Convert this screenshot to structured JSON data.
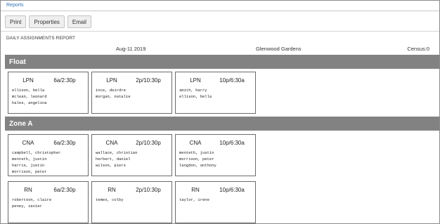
{
  "breadcrumb": "Reports",
  "toolbar": {
    "print": "Print",
    "properties": "Properties",
    "email": "Email"
  },
  "report": {
    "title": "DAILY ASSIGNMENTS REPORT",
    "date": "Aug-11 2019",
    "facility": "Glenwood Gardens",
    "census": "Census:0"
  },
  "zones": [
    {
      "name": "Float",
      "rows": [
        [
          {
            "role": "LPN",
            "shift": "6a/2:30p",
            "staff": [
              "ellison, bella",
              "mclean, leonard",
              "hales, angelina"
            ]
          },
          {
            "role": "LPN",
            "shift": "2p/10:30p",
            "staff": [
              "ince, deirdre",
              "morgan, natalie"
            ]
          },
          {
            "role": "LPN",
            "shift": "10p/6:30a",
            "staff": [
              "smith, harry",
              "ellison, bella"
            ]
          }
        ]
      ]
    },
    {
      "name": "Zone A",
      "rows": [
        [
          {
            "role": "CNA",
            "shift": "6a/2:30p",
            "staff": [
              "campbell, christopher",
              "menteth, justin",
              "harris, justin",
              "morrison, peter"
            ]
          },
          {
            "role": "CNA",
            "shift": "2p/10:30p",
            "staff": [
              "wallace, christian",
              "herbert, daniel",
              "wilson, piers"
            ]
          },
          {
            "role": "CNA",
            "shift": "10p/6:30a",
            "staff": [
              "menteth, justin",
              "morrison, peter",
              "langdon, anthony"
            ]
          }
        ],
        [
          {
            "role": "RN",
            "shift": "6a/2:30p",
            "staff": [
              "robertson, claire",
              "peney, xavier"
            ]
          },
          {
            "role": "RN",
            "shift": "2p/10:30p",
            "staff": [
              "temes, colby"
            ]
          },
          {
            "role": "RN",
            "shift": "10p/6:30a",
            "staff": [
              "taylor, irene"
            ]
          }
        ]
      ]
    }
  ]
}
